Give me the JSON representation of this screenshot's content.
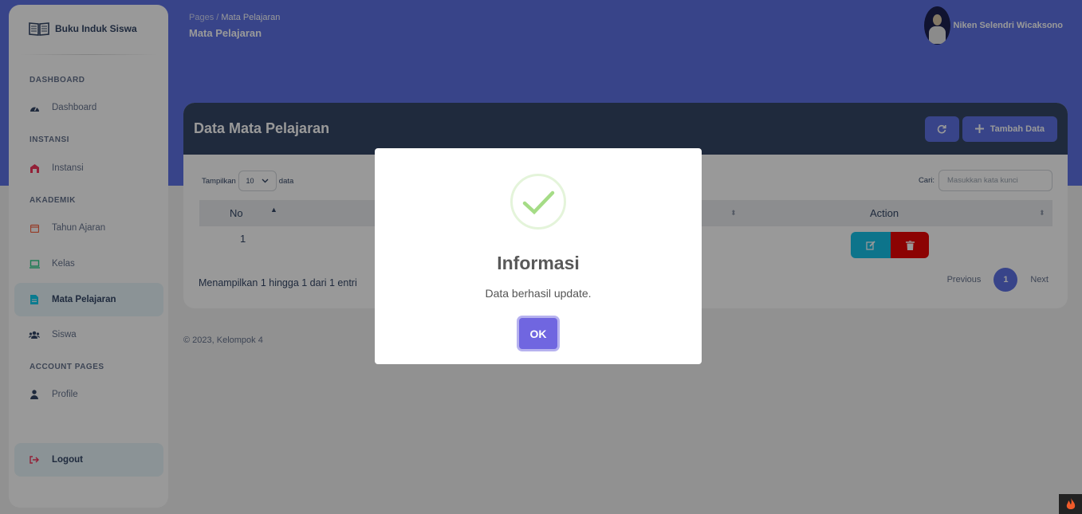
{
  "sidebar": {
    "brand": "Buku Induk Siswa",
    "sections": {
      "dashboard": "DASHBOARD",
      "instansi": "INSTANSI",
      "akademik": "AKADEMIK",
      "account": "ACCOUNT PAGES"
    },
    "items": {
      "dashboard": "Dashboard",
      "instansi": "Instansi",
      "tahun_ajaran": "Tahun Ajaran",
      "kelas": "Kelas",
      "mata_pelajaran": "Mata Pelajaran",
      "siswa": "Siswa",
      "profile": "Profile",
      "logout": "Logout"
    },
    "active_item": "Mata Pelajaran"
  },
  "header": {
    "breadcrumb_root": "Pages",
    "breadcrumb_sep": "/",
    "breadcrumb_current": "Mata Pelajaran",
    "page_title": "Mata Pelajaran",
    "user_name": "Niken Selendri Wicaksono"
  },
  "card": {
    "title": "Data Mata Pelajaran",
    "add_button": "Tambah Data",
    "show_label": "Tampilkan",
    "page_size": "10",
    "entries_label": "data",
    "search_label": "Cari:",
    "search_placeholder": "Masukkan kata kunci",
    "columns": {
      "no": "No",
      "action": "Action"
    },
    "rows": [
      {
        "no": "1"
      }
    ],
    "info": "Menampilkan 1 hingga 1 dari 1 entri",
    "pagination": {
      "previous": "Previous",
      "current": "1",
      "next": "Next"
    }
  },
  "footer": "© 2023, Kelompok 4",
  "modal": {
    "title": "Informasi",
    "message": "Data berhasil update.",
    "ok": "OK",
    "icon": "success-check-icon"
  },
  "colors": {
    "primary": "#5e72e4",
    "card_header": "#344767",
    "edit": "#17c1e8",
    "delete": "#ea0606",
    "ok_button": "#7066e0",
    "success": "#a5dc86"
  }
}
